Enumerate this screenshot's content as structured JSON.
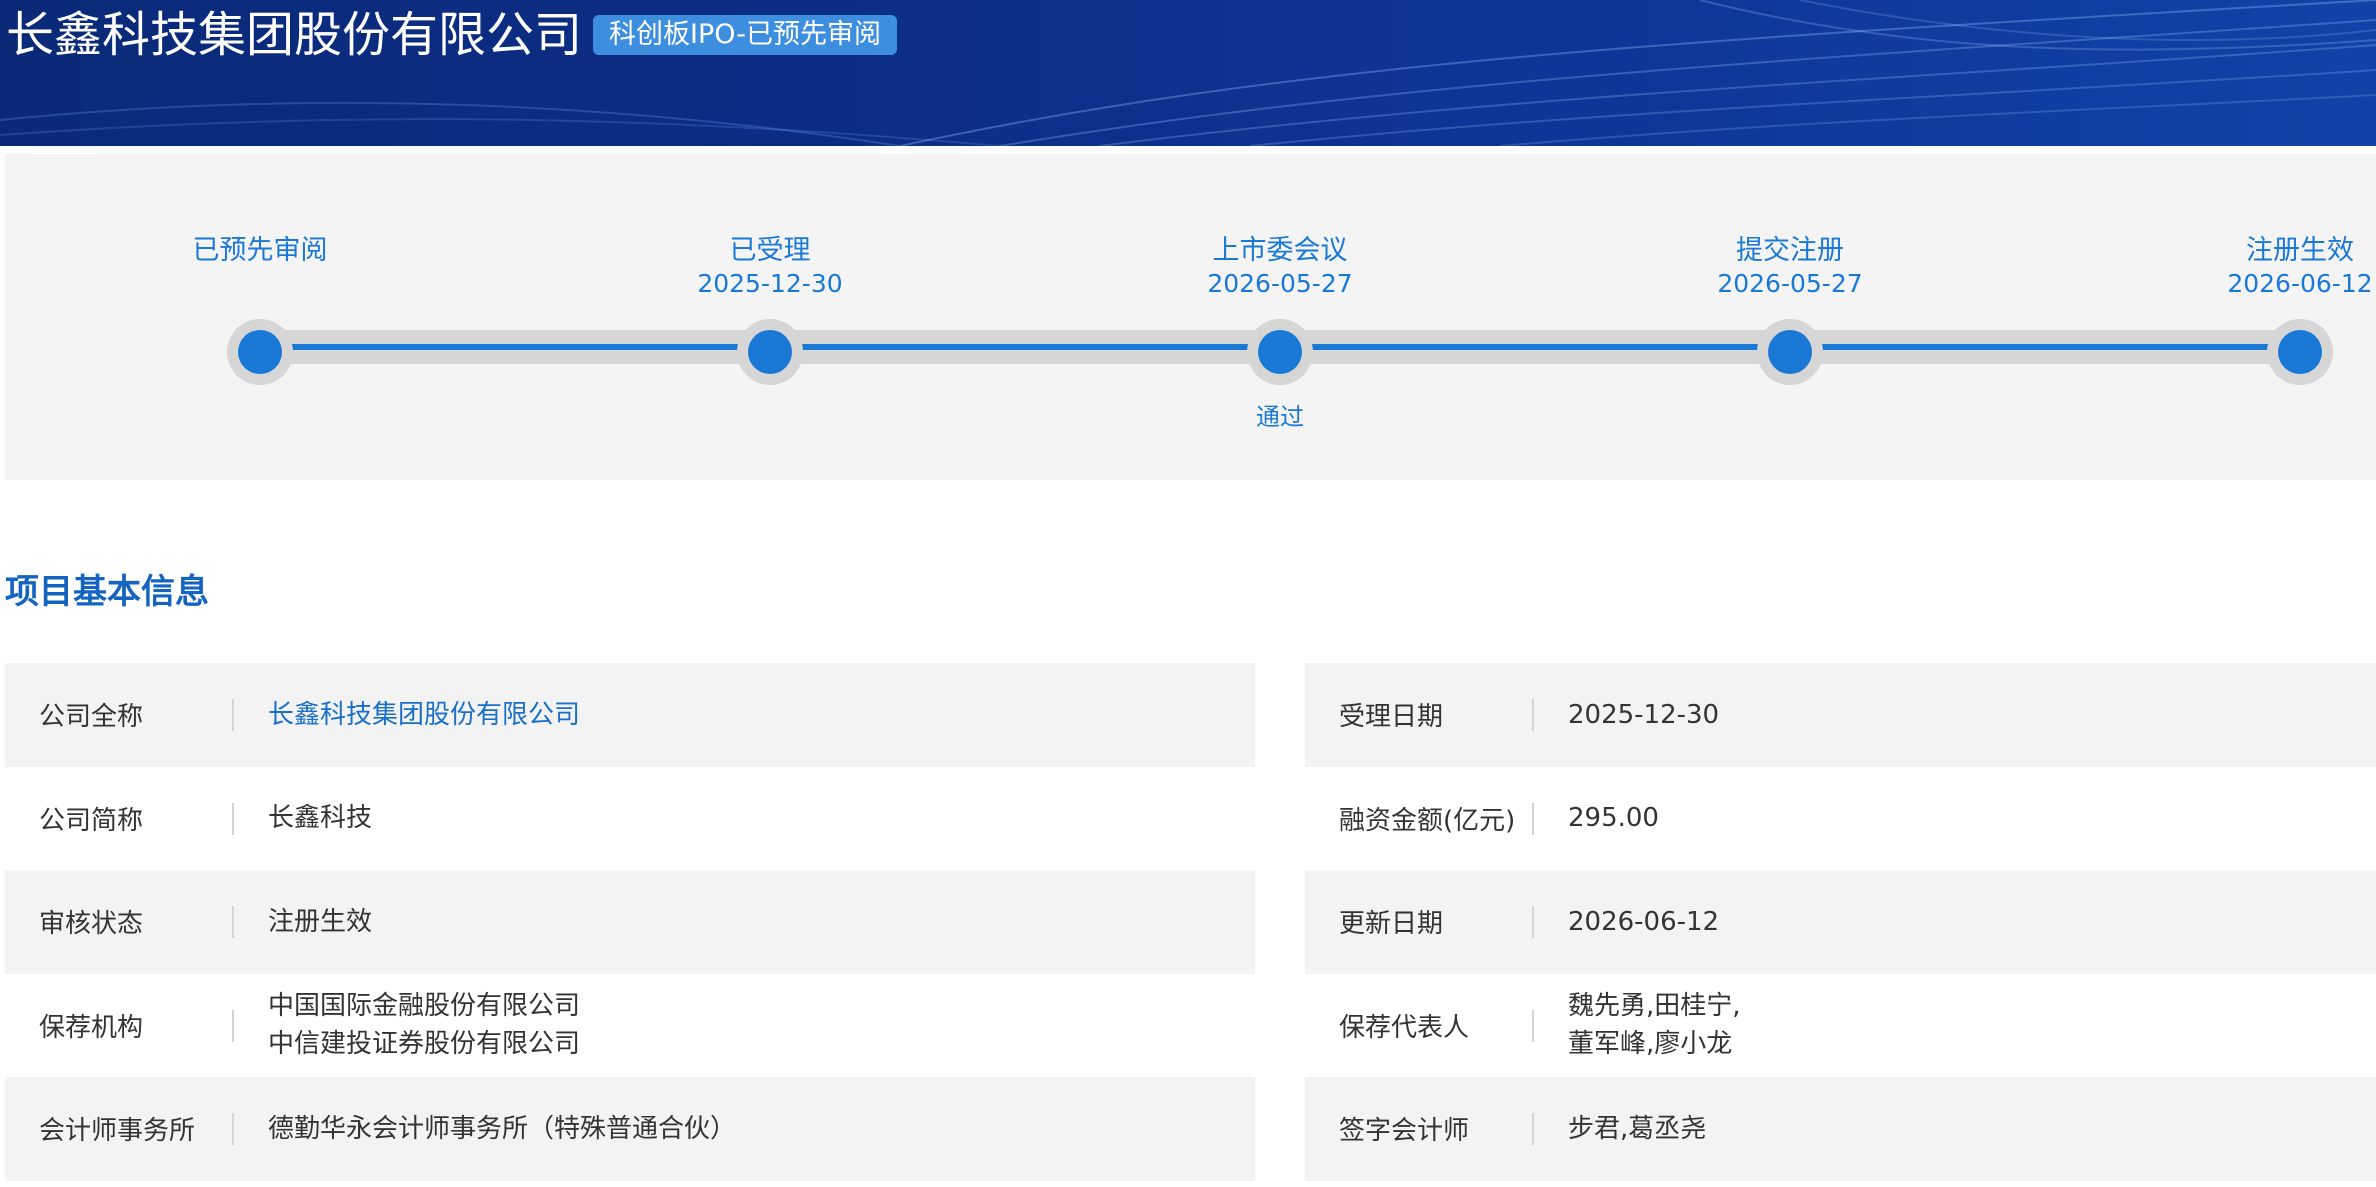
{
  "header": {
    "company_name": "长鑫科技集团股份有限公司",
    "badge": "科创板IPO-已预先审阅",
    "banner_color": "#0c2d86",
    "badge_color": "#3e8ee0"
  },
  "progress": {
    "accent_color": "#1a78d6",
    "steps": [
      {
        "label": "已预先审阅",
        "date": ""
      },
      {
        "label": "已受理",
        "date": "2025-12-30"
      },
      {
        "label": "上市委会议",
        "date": "2026-05-27",
        "note": "通过"
      },
      {
        "label": "提交注册",
        "date": "2026-05-27"
      },
      {
        "label": "注册生效",
        "date": "2026-06-12"
      }
    ]
  },
  "section": {
    "title": "项目基本信息"
  },
  "info": {
    "left": [
      {
        "label": "公司全称",
        "value": [
          "长鑫科技集团股份有限公司"
        ],
        "link": true
      },
      {
        "label": "公司简称",
        "value": [
          "长鑫科技"
        ]
      },
      {
        "label": "审核状态",
        "value": [
          "注册生效"
        ]
      },
      {
        "label": "保荐机构",
        "value": [
          "中国国际金融股份有限公司",
          "中信建投证券股份有限公司"
        ]
      },
      {
        "label": "会计师事务所",
        "value": [
          "德勤华永会计师事务所（特殊普通合伙）"
        ]
      }
    ],
    "right": [
      {
        "label": "受理日期",
        "value": [
          "2025-12-30"
        ]
      },
      {
        "label": "融资金额(亿元)",
        "value": [
          "295.00"
        ]
      },
      {
        "label": "更新日期",
        "value": [
          "2026-06-12"
        ]
      },
      {
        "label": "保荐代表人",
        "value": [
          "魏先勇,田桂宁,",
          "董军峰,廖小龙"
        ]
      },
      {
        "label": "签字会计师",
        "value": [
          "步君,葛丞尧"
        ]
      }
    ]
  }
}
